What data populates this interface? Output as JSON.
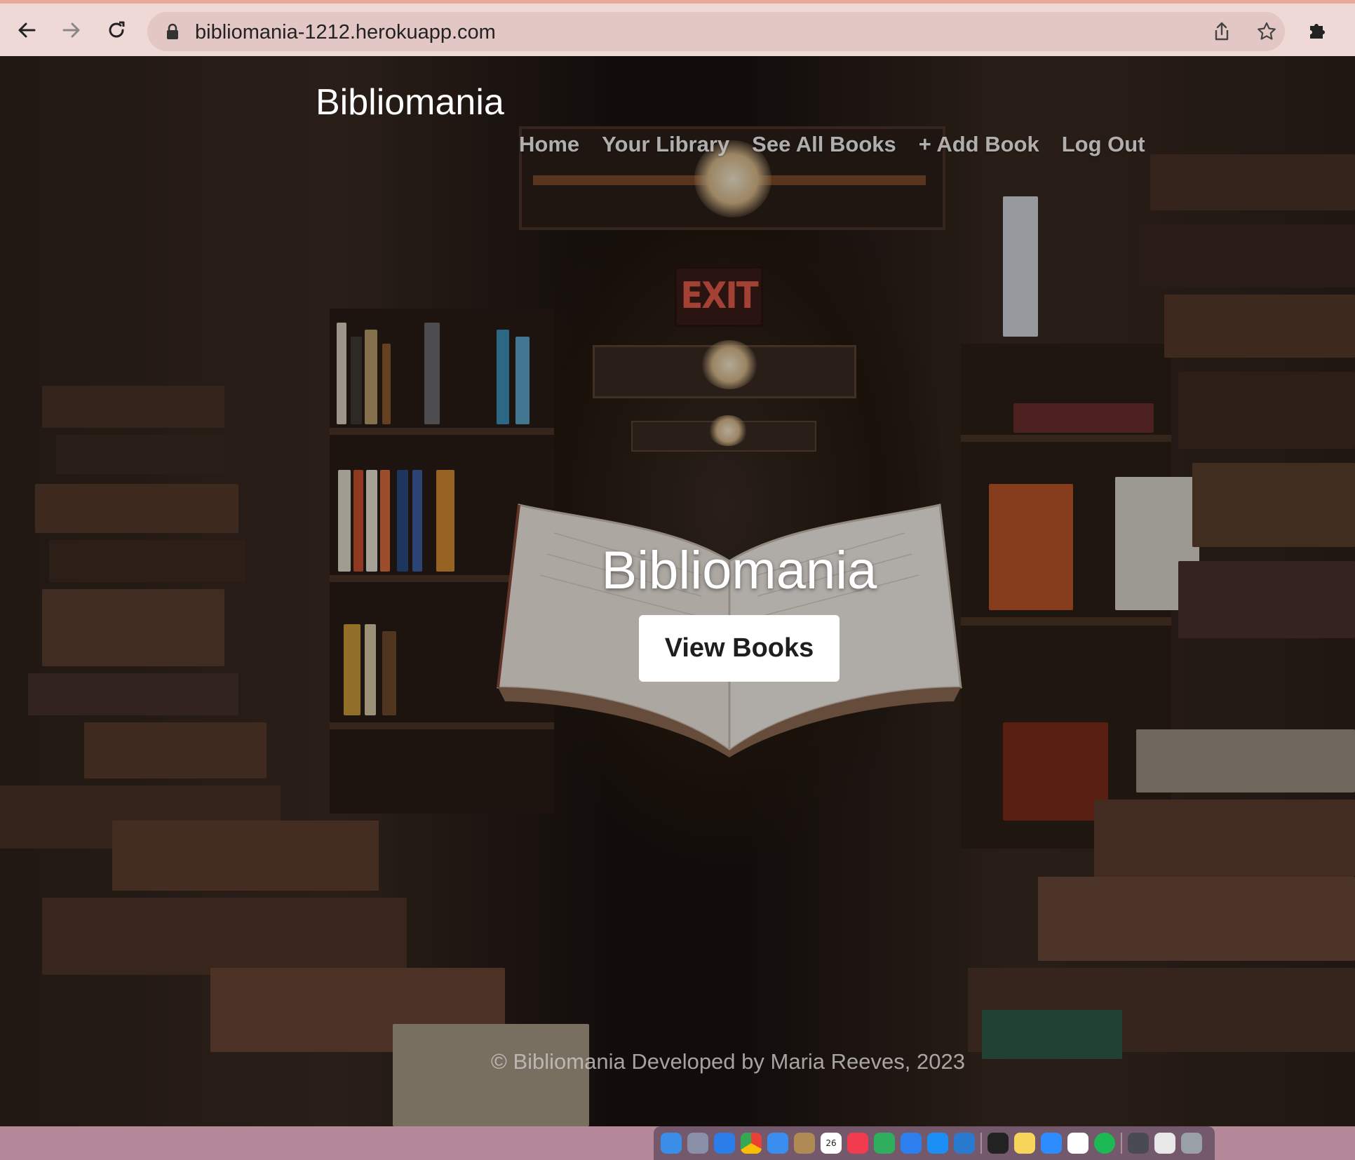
{
  "browser": {
    "url": "bibliomania-1212.herokuapp.com",
    "icons": [
      "back-arrow-icon",
      "forward-arrow-icon",
      "reload-icon",
      "lock-icon",
      "share-icon",
      "star-icon",
      "extensions-puzzle-icon"
    ]
  },
  "site": {
    "brand": "Bibliomania",
    "nav": {
      "home": "Home",
      "library": "Your Library",
      "all_books": "See All Books",
      "add_book": "+ Add Book",
      "logout": "Log Out"
    },
    "hero": {
      "title": "Bibliomania",
      "button": "View Books"
    },
    "footer": "© Bibliomania Developed by Maria Reeves, 2023"
  },
  "background": {
    "exit_sign": "EXIT"
  },
  "dock": {
    "calendar_day": "26",
    "apps": [
      "finder-icon",
      "launchpad-icon",
      "safari-icon",
      "chrome-icon",
      "mail-icon",
      "contacts-icon",
      "calendar-icon",
      "news-icon",
      "numbers-icon",
      "keynote-icon",
      "app-store-icon",
      "vscode-icon",
      "terminal-icon",
      "notes-icon",
      "zoom-icon",
      "slack-icon",
      "spotify-icon",
      "activity-monitor-icon",
      "preview-icon",
      "trash-icon"
    ]
  },
  "colors": {
    "browser_bar": "#efd9d6",
    "omnibox": "#e3c7c4",
    "hero_button_bg": "#ffffff",
    "desktop": "#b5899a"
  }
}
